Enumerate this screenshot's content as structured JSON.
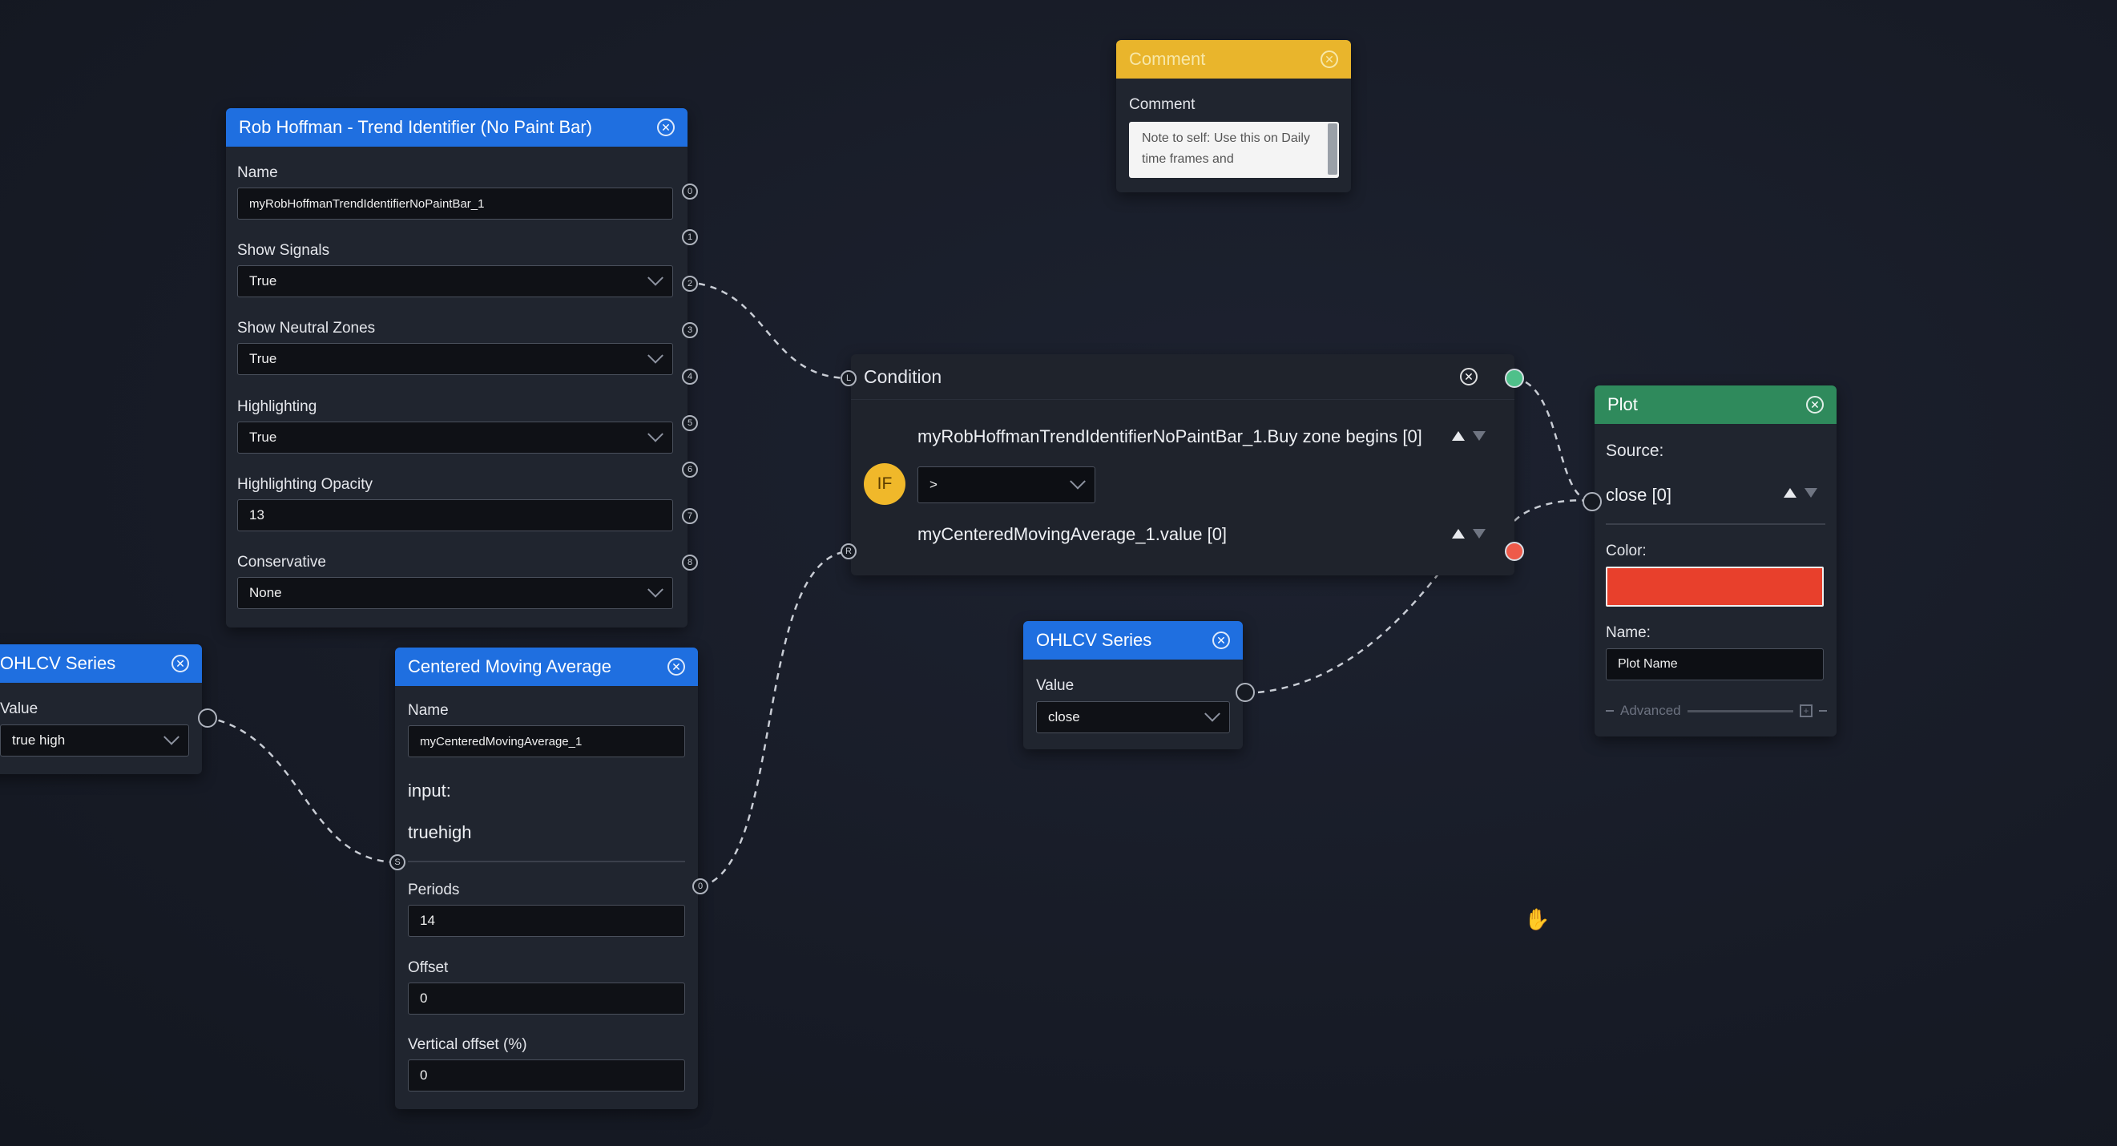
{
  "comment_node": {
    "title": "Comment",
    "label": "Comment",
    "text": "Note to self: Use this on Daily time frames and"
  },
  "trend_node": {
    "title": "Rob Hoffman - Trend Identifier (No Paint Bar)",
    "name_label": "Name",
    "name_value": "myRobHoffmanTrendIdentifierNoPaintBar_1",
    "show_signals_label": "Show Signals",
    "show_signals_value": "True",
    "show_neutral_label": "Show Neutral Zones",
    "show_neutral_value": "True",
    "highlighting_label": "Highlighting",
    "highlighting_value": "True",
    "opacity_label": "Highlighting Opacity",
    "opacity_value": "13",
    "conservative_label": "Conservative",
    "conservative_value": "None",
    "ports": [
      "0",
      "1",
      "2",
      "3",
      "4",
      "5",
      "6",
      "7",
      "8"
    ]
  },
  "condition_node": {
    "title": "Condition",
    "if_label": "IF",
    "left_operand": "myRobHoffmanTrendIdentifierNoPaintBar_1.Buy zone begins [0]",
    "operator": ">",
    "right_operand": "myCenteredMovingAverage_1.value [0]"
  },
  "plot_node": {
    "title": "Plot",
    "source_label": "Source:",
    "source_value": "close [0]",
    "color_label": "Color:",
    "color_value": "#e8402c",
    "name_label": "Name:",
    "name_value": "Plot Name",
    "advanced_label": "Advanced"
  },
  "ohlcv_left": {
    "title": "OHLCV Series",
    "value_label": "Value",
    "value": "true high"
  },
  "ohlcv_mid": {
    "title": "OHLCV Series",
    "value_label": "Value",
    "value": "close"
  },
  "cma_node": {
    "title": "Centered Moving Average",
    "name_label": "Name",
    "name_value": "myCenteredMovingAverage_1",
    "input_label": "input:",
    "input_value": "truehigh",
    "periods_label": "Periods",
    "periods_value": "14",
    "offset_label": "Offset",
    "offset_value": "0",
    "voffset_label": "Vertical offset (%)",
    "voffset_value": "0"
  },
  "colors": {
    "node_header_blue": "#1f6fe0",
    "node_header_green": "#2f8a5c",
    "node_header_yellow": "#e9b52c",
    "if_badge": "#f0b82a",
    "true_port": "#4fc08a",
    "false_port": "#ee5a4a"
  }
}
